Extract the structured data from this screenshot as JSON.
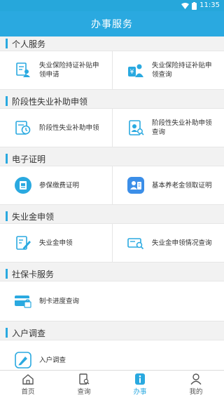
{
  "status_bar": {
    "time": "11:35"
  },
  "header": {
    "title": "办事服务"
  },
  "sections": [
    {
      "title": "个人服务",
      "items": [
        {
          "label": "失业保险持证补贴申领申请",
          "icon": "document-person-icon"
        },
        {
          "label": "失业保险持证补贴申领查询",
          "icon": "money-person-icon"
        }
      ]
    },
    {
      "title": "阶段性失业补助申领",
      "items": [
        {
          "label": "阶段性失业补助申领",
          "icon": "calendar-clock-icon"
        },
        {
          "label": "阶段性失业补助申领查询",
          "icon": "search-person-icon"
        }
      ]
    },
    {
      "title": "电子证明",
      "items": [
        {
          "label": "参保缴费证明",
          "icon": "certificate-icon"
        },
        {
          "label": "基本养老金领取证明",
          "icon": "pension-certificate-icon"
        }
      ]
    },
    {
      "title": "失业金申领",
      "items": [
        {
          "label": "失业金申领",
          "icon": "edit-form-icon"
        },
        {
          "label": "失业金申领情况查询",
          "icon": "card-search-icon"
        }
      ]
    },
    {
      "title": "社保卡服务",
      "items": [
        {
          "label": "制卡进度查询",
          "icon": "card-lock-icon"
        }
      ]
    },
    {
      "title": "入户调查",
      "items": [
        {
          "label": "入户调查",
          "icon": "pencil-survey-icon"
        }
      ]
    }
  ],
  "tabs": [
    {
      "label": "首页",
      "icon": "home-icon",
      "active": false
    },
    {
      "label": "查询",
      "icon": "query-icon",
      "active": false
    },
    {
      "label": "办事",
      "icon": "info-icon",
      "active": true
    },
    {
      "label": "我的",
      "icon": "user-icon",
      "active": false
    }
  ],
  "colors": {
    "primary": "#2aa9e0",
    "background": "#f2f2f2"
  }
}
